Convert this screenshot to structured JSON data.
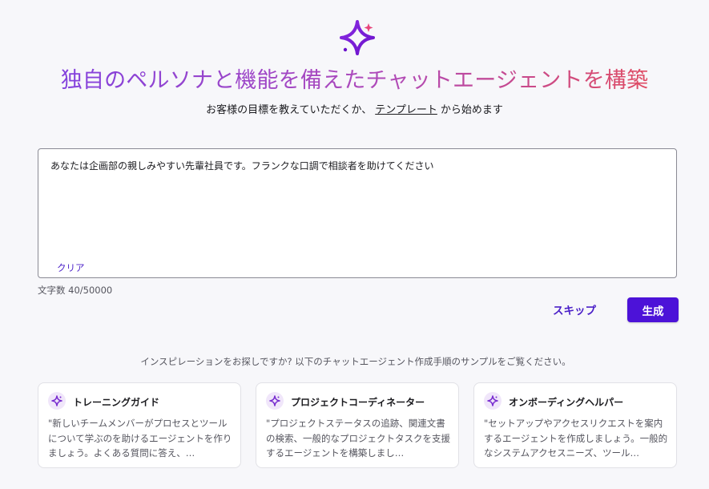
{
  "hero": {
    "title": "独自のペルソナと機能を備えたチャットエージェントを構築",
    "subtitle_before": "お客様の目標を教えていただくか、",
    "subtitle_link": "テンプレート",
    "subtitle_after": "から始めます"
  },
  "prompt": {
    "value": "あなたは企画部の親しみやすい先輩社員です。フランクな口調で相談者を助けてください",
    "clear_label": "クリア",
    "char_count": "文字数 40/50000"
  },
  "actions": {
    "skip_label": "スキップ",
    "generate_label": "生成"
  },
  "inspiration": {
    "text": "インスピレーションをお探しですか? 以下のチャットエージェント作成手順のサンプルをご覧ください。",
    "cards": [
      {
        "title": "トレーニングガイド",
        "description": "\"新しいチームメンバーがプロセスとツールについて学ぶのを助けるエージェントを作りましょう。よくある質問に答え、…"
      },
      {
        "title": "プロジェクトコーディネーター",
        "description": "\"プロジェクトステータスの追跡、関連文書の検索、一般的なプロジェクトタスクを支援するエージェントを構築しまし…"
      },
      {
        "title": "オンボーディングヘルパー",
        "description": "\"セットアップやアクセスリクエストを案内するエージェントを作成しましょう。一般的なシステムアクセスニーズ、ツール…"
      }
    ]
  },
  "icons": {
    "logo": "sparkle-icon",
    "card": "sparkle-icon"
  },
  "colors": {
    "accent": "#4c12d8",
    "link": "#4a1fc8",
    "gradient_start": "#7b3fe4",
    "gradient_end": "#ea4b4f",
    "background": "#f7f7fa"
  }
}
